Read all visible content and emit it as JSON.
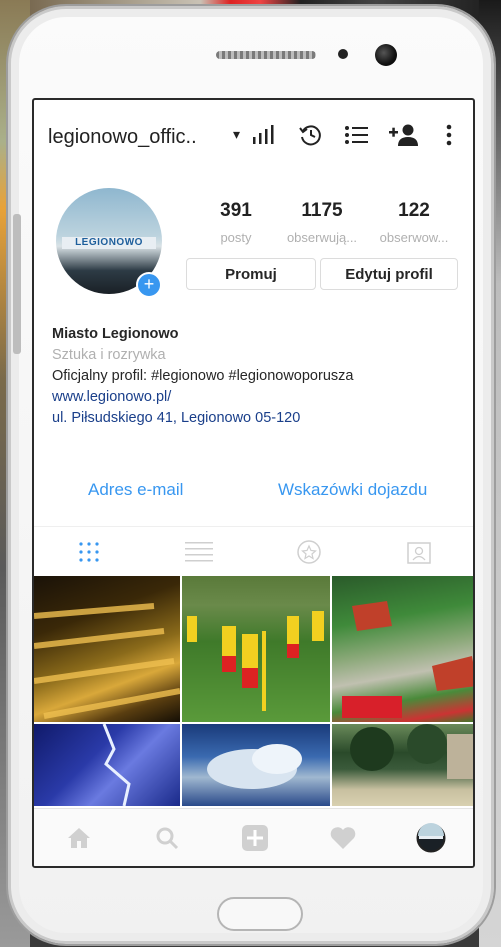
{
  "header": {
    "username": "legionowo_offic..",
    "caret": "▾"
  },
  "avatar": {
    "logo_text": "LEGIONOWO",
    "add_icon": "+"
  },
  "stats": [
    {
      "value": "391",
      "label": "posty"
    },
    {
      "value": "1175",
      "label": "obserwują..."
    },
    {
      "value": "122",
      "label": "obserwow..."
    }
  ],
  "buttons": {
    "promote": "Promuj",
    "edit_profile": "Edytuj profil"
  },
  "bio": {
    "name": "Miasto Legionowo",
    "category": "Sztuka i rozrywka",
    "description": "Oficjalny profil: #legionowo #legionowoporusza",
    "website": "www.legionowo.pl/",
    "address": "ul. Piłsudskiego 41, Legionowo 05-120"
  },
  "contact": {
    "email": "Adres e-mail",
    "directions": "Wskazówki dojazdu"
  },
  "tabs": [
    "grid-icon",
    "list-icon",
    "saved-icon",
    "tagged-icon"
  ],
  "nav": [
    "home-icon",
    "search-icon",
    "add-icon",
    "heart-icon",
    "profile-icon"
  ],
  "colors": {
    "accent": "#3897f0",
    "link": "#1a3f8a"
  }
}
